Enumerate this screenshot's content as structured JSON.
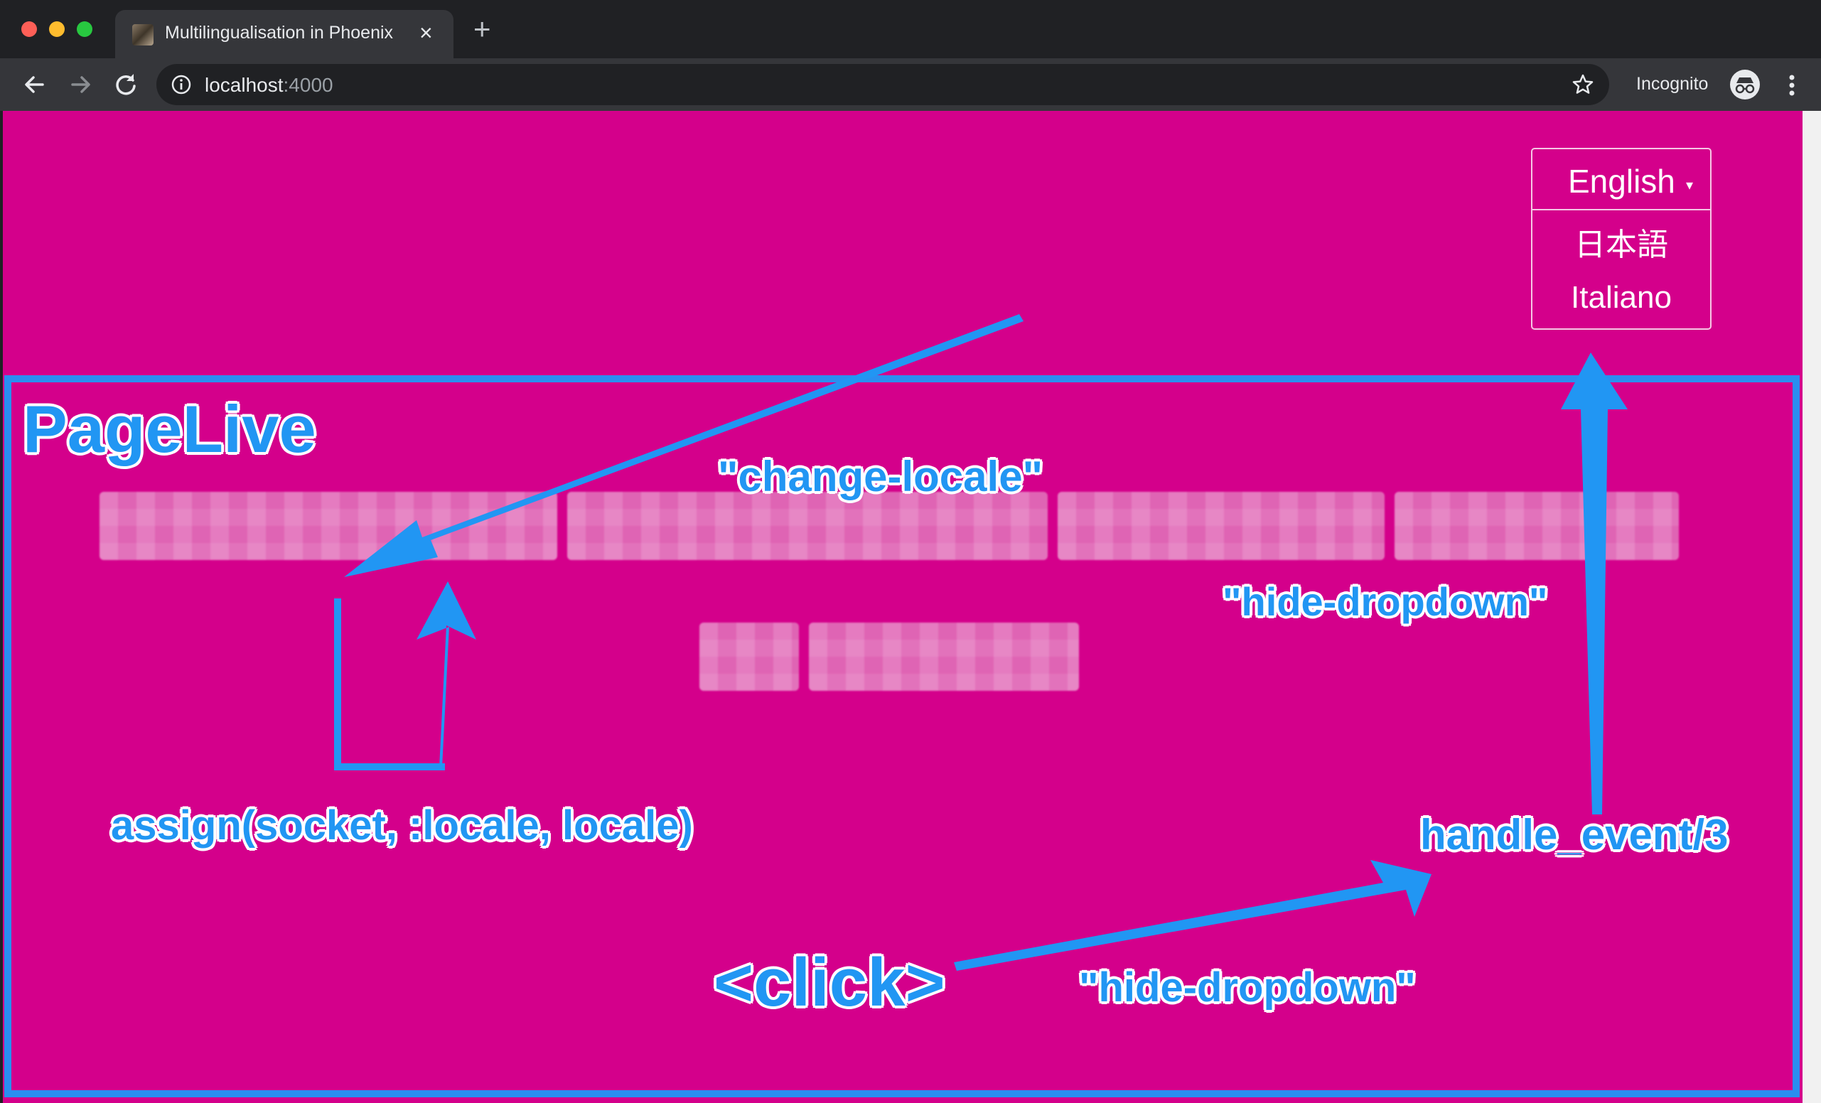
{
  "browser": {
    "tab_title": "Multilingualisation in Phoenix",
    "tab_close": "×",
    "new_tab": "+",
    "url_host": "localhost",
    "url_port": ":4000",
    "incognito_label": "Incognito",
    "icons": [
      "back-arrow-icon",
      "forward-arrow-icon",
      "reload-icon",
      "info-icon",
      "star-icon",
      "incognito-icon",
      "kebab-menu-icon"
    ]
  },
  "language_dropdown": {
    "selected": "English",
    "caret": "▾",
    "options": [
      "日本語",
      "Italiano"
    ]
  },
  "annotations": {
    "page_live": "PageLive",
    "change_locale": "\"change-locale\"",
    "hide_dropdown_top": "\"hide-dropdown\"",
    "assign": "assign(socket, :locale, locale)",
    "handle_event": "handle_event/3",
    "click": "<click>",
    "hide_dropdown_bottom": "\"hide-dropdown\""
  },
  "colors": {
    "page_background": "#d4008b",
    "annotation_blue": "#2196f3",
    "live_box_border": "#2a8ef0"
  }
}
